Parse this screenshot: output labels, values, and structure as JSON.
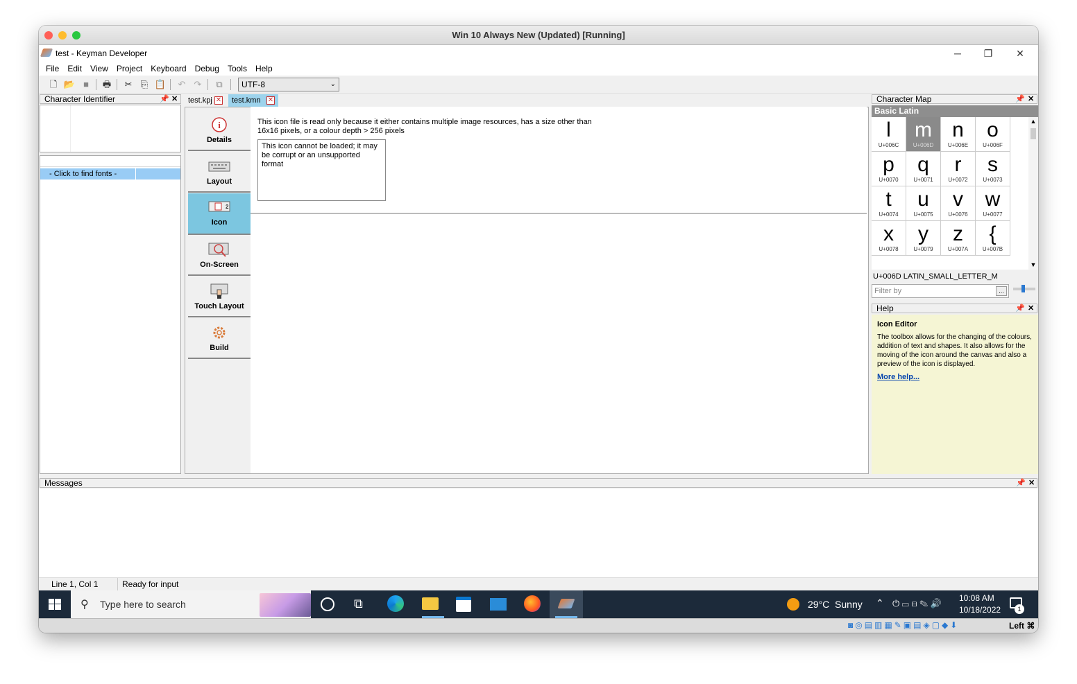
{
  "host": {
    "title": "Win 10 Always New (Updated) [Running]",
    "host_key": "Left ⌘"
  },
  "app": {
    "title": "test - Keyman Developer"
  },
  "window_controls": {
    "minimize": "─",
    "restore": "❐",
    "close": "✕"
  },
  "menu": [
    "File",
    "Edit",
    "View",
    "Project",
    "Keyboard",
    "Debug",
    "Tools",
    "Help"
  ],
  "toolbar": {
    "encoding": "UTF-8"
  },
  "char_identifier": {
    "title": "Character Identifier",
    "find_fonts": "- Click to find fonts -"
  },
  "tabs": [
    {
      "label": "test.kpj"
    },
    {
      "label": "test.kmn"
    }
  ],
  "side_buttons": [
    {
      "label": "Details",
      "icon": "info-icon"
    },
    {
      "label": "Layout",
      "icon": "keyboard-icon"
    },
    {
      "label": "Icon",
      "icon": "icon-editor-icon"
    },
    {
      "label": "On-Screen",
      "icon": "onscreen-keyboard-icon"
    },
    {
      "label": "Touch Layout",
      "icon": "touch-icon"
    },
    {
      "label": "Build",
      "icon": "gear-icon"
    }
  ],
  "editor": {
    "notice": "This icon file is read only because it either contains multiple image resources, has a size other than 16x16 pixels, or a colour depth > 256 pixels",
    "error": "This icon cannot be loaded; it may be corrupt or an unsupported format"
  },
  "char_map": {
    "title": "Character Map",
    "section": "Basic Latin",
    "cells": [
      {
        "ch": "l",
        "code": "U+006C"
      },
      {
        "ch": "m",
        "code": "U+006D"
      },
      {
        "ch": "n",
        "code": "U+006E"
      },
      {
        "ch": "o",
        "code": "U+006F"
      },
      {
        "ch": "p",
        "code": "U+0070"
      },
      {
        "ch": "q",
        "code": "U+0071"
      },
      {
        "ch": "r",
        "code": "U+0072"
      },
      {
        "ch": "s",
        "code": "U+0073"
      },
      {
        "ch": "t",
        "code": "U+0074"
      },
      {
        "ch": "u",
        "code": "U+0075"
      },
      {
        "ch": "v",
        "code": "U+0076"
      },
      {
        "ch": "w",
        "code": "U+0077"
      },
      {
        "ch": "x",
        "code": "U+0078"
      },
      {
        "ch": "y",
        "code": "U+0079"
      },
      {
        "ch": "z",
        "code": "U+007A"
      },
      {
        "ch": "{",
        "code": "U+007B"
      }
    ],
    "selected_info": "U+006D LATIN_SMALL_LETTER_M",
    "filter_placeholder": "Filter by",
    "filter_btn": "..."
  },
  "help": {
    "title": "Help",
    "heading": "Icon Editor",
    "body": "The toolbox allows for the changing of the colours, addition of text and shapes. It also allows for the moving of the icon around the canvas and also a preview of the icon is displayed.",
    "link": "More help..."
  },
  "messages": {
    "title": "Messages"
  },
  "status": {
    "position": "Line 1, Col 1",
    "state": "Ready for input"
  },
  "taskbar": {
    "search_placeholder": "Type here to search",
    "weather": "29°C  Sunny",
    "time": "10:08 AM",
    "date": "10/18/2022",
    "notif_count": "1"
  },
  "colors": {
    "selected_tab": "#9dd3ec",
    "selected_side": "#7cc6e0",
    "help_bg": "#f5f5d4",
    "cm_header": "#8e8e8e",
    "cm_selected": "#8a8a8a"
  }
}
